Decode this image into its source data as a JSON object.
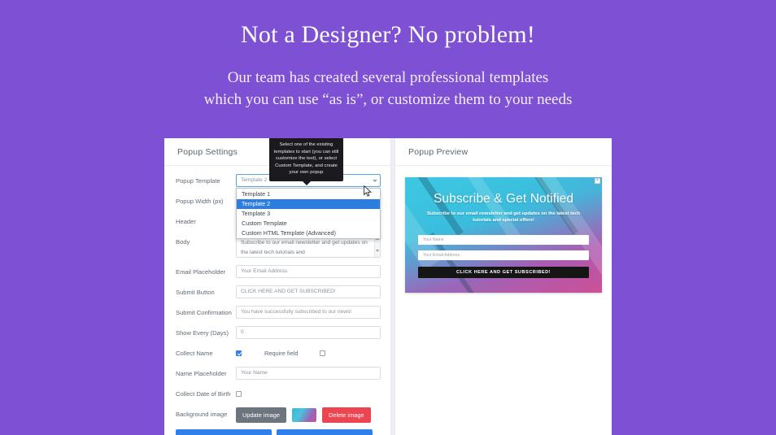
{
  "hero": {
    "title": "Not a Designer? No problem!",
    "subtitle_line1": "Our team has created several professional templates",
    "subtitle_line2": "which you can use “as is”, or customize them to your needs"
  },
  "settings_panel": {
    "title": "Popup Settings",
    "tooltip": "Select one of the existing templates to start (you can still customize the text), or select Custom Template, and create your own popup",
    "fields": {
      "popup_template": {
        "label": "Popup Template",
        "value": "Template 2",
        "options": [
          "Template 1",
          "Template 2",
          "Template 3",
          "Custom Template",
          "Custom HTML Template (Advanced)"
        ],
        "selected_index": 1
      },
      "popup_width": {
        "label": "Popup Width (px)",
        "value": ""
      },
      "header": {
        "label": "Header",
        "value": ""
      },
      "body": {
        "label": "Body",
        "value": "Subscribe to our email newsletter and get updates on the latest tech tutorials and"
      },
      "email_placeholder": {
        "label": "Email Placeholder",
        "value": "Your Email Address"
      },
      "submit_button": {
        "label": "Submit Button",
        "value": "CLICK HERE AND GET SUBSCRIBED!"
      },
      "submit_confirmation": {
        "label": "Submit Confirmation",
        "value": "You have successfully subscribed to our newsl"
      },
      "show_every_days": {
        "label": "Show Every (Days)",
        "value": "0"
      },
      "collect_name": {
        "label": "Collect Name",
        "checked": true,
        "require_label": "Require field",
        "require_checked": false
      },
      "name_placeholder": {
        "label": "Name Placeholder",
        "value": "Your Name"
      },
      "collect_dob": {
        "label": "Collect Date of Birth",
        "checked": false
      },
      "background_image": {
        "label": "Background image",
        "update_label": "Update image",
        "delete_label": "Delete image"
      }
    }
  },
  "preview_panel": {
    "title": "Popup Preview",
    "close_label": "×",
    "popup": {
      "heading": "Subscribe & Get Notified",
      "subtext": "Subscribe to our email newsletter and get updates on the latest tech tutorials and special offers!",
      "name_placeholder": "Your Name",
      "email_placeholder": "Your Email Address",
      "submit_label": "CLICK HERE AND GET SUBSCRIBED!"
    }
  },
  "colors": {
    "background": "#7e51d4",
    "accent_blue": "#2f80ed",
    "danger_red": "#ec4551",
    "neutral_gray": "#6c757d"
  }
}
